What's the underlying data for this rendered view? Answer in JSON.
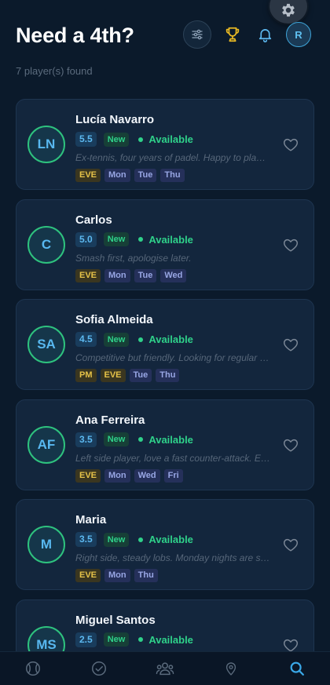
{
  "header": {
    "title": "Need a 4th?",
    "avatar_initial": "R",
    "results_count": "7 player(s) found"
  },
  "icons": {
    "settings": "gear-icon",
    "filter": "sliders-icon",
    "trophy": "trophy-icon",
    "notifications": "bell-icon",
    "favorite": "heart-outline-icon"
  },
  "colors": {
    "background": "#0b1a2b",
    "card": "#13263d",
    "accent_green": "#2fd18a",
    "accent_blue": "#5cb8ef",
    "trophy": "#e8b923"
  },
  "players": [
    {
      "initials": "LN",
      "name": "Lucía Navarro",
      "rating": "5.5",
      "badge": "New",
      "status": "Available",
      "bio": "Ex-tennis, four years of padel. Happy to play any side.",
      "times": [
        "EVE"
      ],
      "days": [
        "Mon",
        "Tue",
        "Thu"
      ]
    },
    {
      "initials": "C",
      "name": "Carlos",
      "rating": "5.0",
      "badge": "New",
      "status": "Available",
      "bio": "Smash first, apologise later.",
      "times": [
        "EVE"
      ],
      "days": [
        "Mon",
        "Tue",
        "Wed"
      ]
    },
    {
      "initials": "SA",
      "name": "Sofia Almeida",
      "rating": "4.5",
      "badge": "New",
      "status": "Available",
      "bio": "Competitive but friendly. Looking for regular partners.",
      "times": [
        "PM",
        "EVE"
      ],
      "days": [
        "Tue",
        "Thu"
      ]
    },
    {
      "initials": "AF",
      "name": "Ana Ferreira",
      "rating": "3.5",
      "badge": "New",
      "status": "Available",
      "bio": "Left side player, love a fast counter-attack. Evenings preferred.",
      "times": [
        "EVE"
      ],
      "days": [
        "Mon",
        "Wed",
        "Fri"
      ]
    },
    {
      "initials": "M",
      "name": "Maria",
      "rating": "3.5",
      "badge": "New",
      "status": "Available",
      "bio": "Right side, steady lobs. Monday nights are sacred.",
      "times": [
        "EVE"
      ],
      "days": [
        "Mon",
        "Thu"
      ]
    },
    {
      "initials": "MS",
      "name": "Miguel Santos",
      "rating": "2.5",
      "badge": "New",
      "status": "Available",
      "bio": "",
      "times": [],
      "days": []
    }
  ],
  "bottom_nav": [
    {
      "id": "nav-play",
      "icon": "padel-ball-icon",
      "active": false
    },
    {
      "id": "nav-matches",
      "icon": "check-circle-icon",
      "active": false
    },
    {
      "id": "nav-community",
      "icon": "people-icon",
      "active": false
    },
    {
      "id": "nav-courts",
      "icon": "map-pin-icon",
      "active": false
    },
    {
      "id": "nav-search",
      "icon": "search-icon",
      "active": true
    }
  ]
}
